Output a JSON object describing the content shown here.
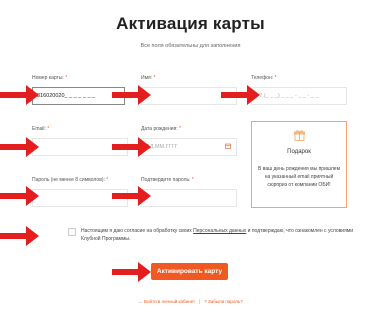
{
  "header": {
    "title": "Активация карты",
    "subtitle": "Все поля обязательны для заполнения"
  },
  "form": {
    "card_number_label": "Номер карты:",
    "card_number_value": "316020020_ _ _ _ _ _ _",
    "name_label": "Имя:",
    "phone_label": "Телефон:",
    "phone_placeholder": "+7 (_ _ _) _ _ _ - _ _ - _ _",
    "email_label": "Email:",
    "birthdate_label": "Дата рождения:",
    "birthdate_placeholder": "ДД.ММ.ГГГГ",
    "password_label": "Пароль (не менее 8 символов):",
    "confirm_label": "Подтвердите пароль:",
    "required_mark": "*"
  },
  "gift": {
    "title": "Подарок",
    "text": "В ваш день рождения мы пришлем на указанный email приятный сюрприз от компании ОБИ!"
  },
  "consent": {
    "text_before": "Настоящим я даю согласие на обработку своих ",
    "link": "Персональных данных",
    "text_after": " и подтверждаю, что ознакомлен с условиями Клубной Программы."
  },
  "submit_label": "Активировать карту",
  "links": {
    "login": "Войти в личный кабинет",
    "forgot": "Забыли пароль?",
    "login_prefix": "→",
    "forgot_prefix": "?"
  },
  "colors": {
    "accent": "#f05a22",
    "arrow": "#e41e1e",
    "border": "#e6e6e6",
    "gift_border": "#f2a765"
  },
  "icons": {
    "gift": "gift-icon",
    "calendar": "calendar-icon",
    "arrow": "red-arrow-icon"
  }
}
